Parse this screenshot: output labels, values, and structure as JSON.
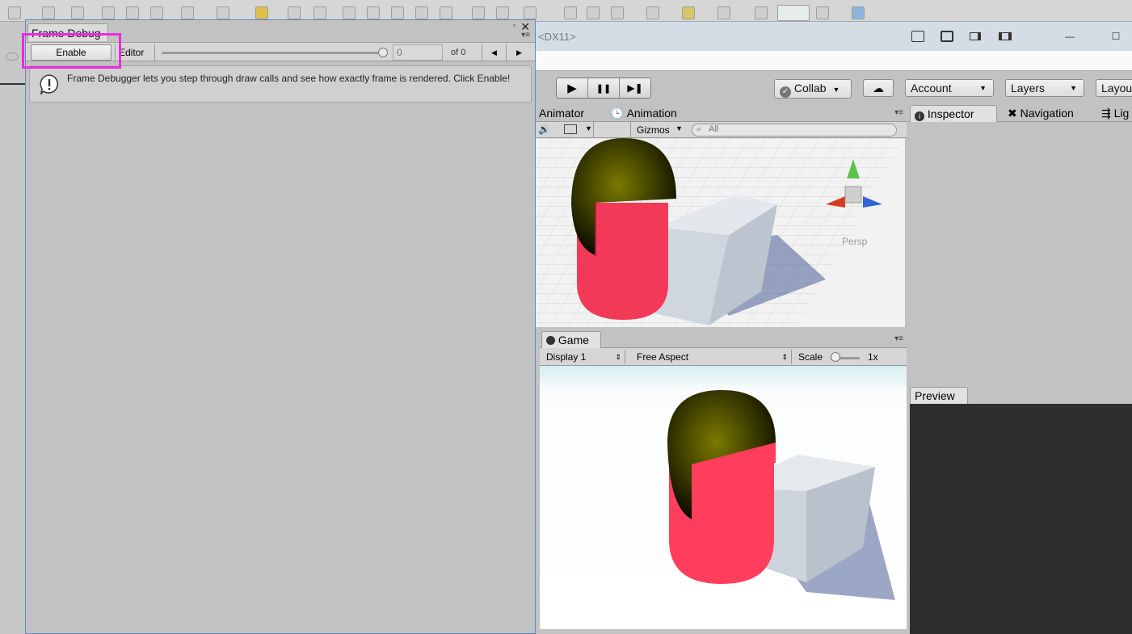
{
  "editor": {
    "title_suffix": "<DX11>",
    "minimize": "—",
    "maximize": "☐"
  },
  "toolbar": {
    "play": "▶",
    "pause": "❚❚",
    "step": "▶❚",
    "collab": "Collab",
    "account": "Account",
    "layers": "Layers",
    "layout": "Layou"
  },
  "scene": {
    "tabs": [
      "Animator",
      "Animation"
    ],
    "gizmos": "Gizmos",
    "search_placeholder": "All",
    "persp_label": "Persp"
  },
  "game": {
    "tab": "Game",
    "display": "Display 1",
    "aspect": "Free Aspect",
    "scale_label": "Scale",
    "scale_value": "1x"
  },
  "inspector": {
    "tabs": [
      "Inspector",
      "Navigation",
      "Lig"
    ],
    "preview_tab": "Preview"
  },
  "frame_debugger": {
    "tab_label": "Frame Debug",
    "enable_button": "Enable",
    "mode_dropdown": "Editor",
    "frame_value": "0",
    "of_label": "of 0",
    "info_text": "Frame Debugger lets you step through draw calls and see how exactly frame is rendered. Click Enable!",
    "close": "✕",
    "maximize": "▫"
  },
  "colors": {
    "highlight": "#e92ce0",
    "window_border": "#5a8ac6",
    "capsule": "#ff3d5c",
    "capsule_top": "#6b6a00"
  }
}
